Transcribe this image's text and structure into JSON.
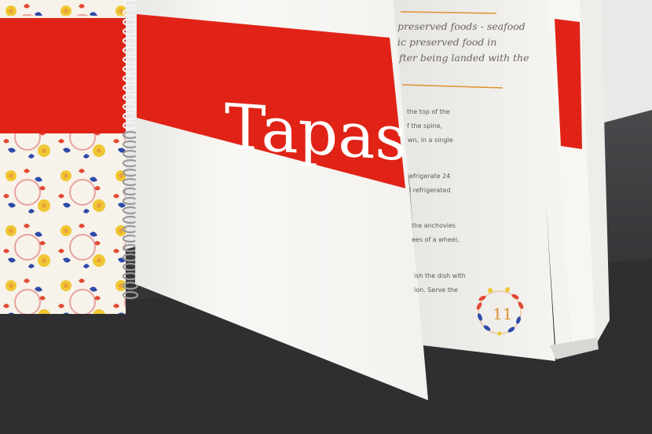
{
  "title": "Tapas",
  "page_number": "11",
  "text_lines": [
    "preserved foods - seafood",
    "ic preserved food in",
    "fter being landed with the",
    "the top of the",
    "f the spine,",
    "wn, in a single",
    "efrigerate 24",
    "l refrigerated",
    "the anchovies",
    "ees of a wheel,",
    "ish the dish with",
    "ion. Serve the"
  ],
  "colors": {
    "band_red": "#e02316",
    "accent_orange": "#e0902f",
    "pattern_yellow": "#f0c733",
    "pattern_blue": "#2e4aa8",
    "page_white": "#f7f6f3",
    "table": "#333336",
    "wall": "#e9e9e7"
  },
  "icons": {
    "laurel_wreath": "laurel-wreath-icon",
    "spiral_binding": "spiral-binding",
    "floral_pattern": "floral-pattern"
  }
}
